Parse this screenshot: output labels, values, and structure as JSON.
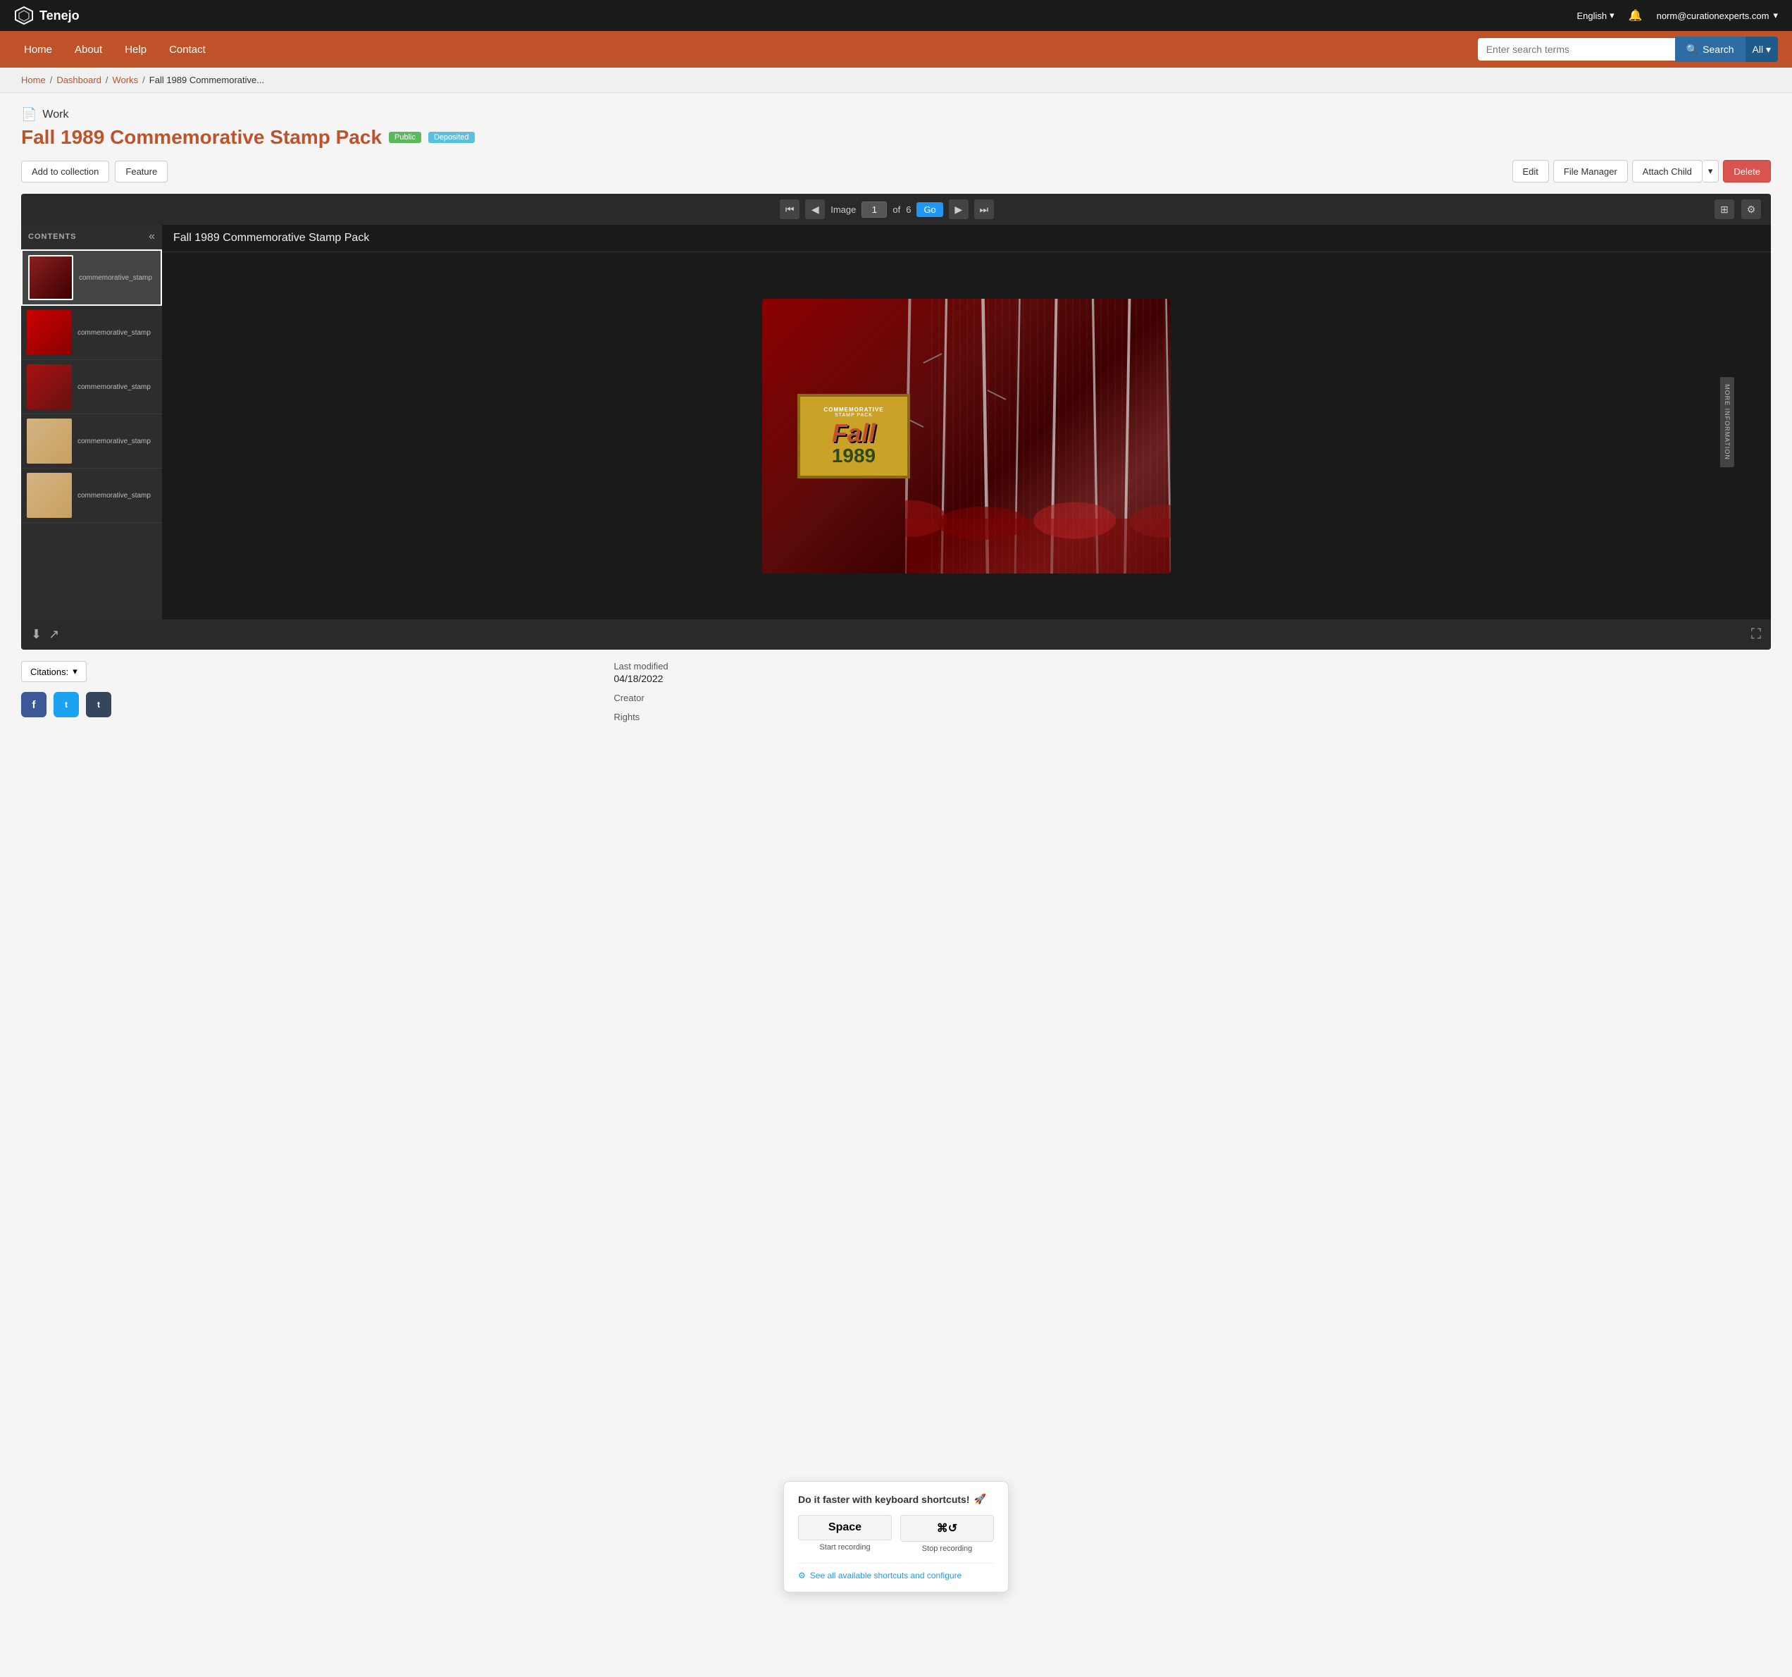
{
  "topbar": {
    "logo": "Tenejo",
    "language": "English",
    "bell_label": "Notifications",
    "user": "norm@curationexperts.com",
    "user_dropdown": "▾",
    "lang_dropdown": "▾"
  },
  "navbar": {
    "links": [
      {
        "label": "Home",
        "href": "#"
      },
      {
        "label": "About",
        "href": "#"
      },
      {
        "label": "Help",
        "href": "#"
      },
      {
        "label": "Contact",
        "href": "#"
      }
    ],
    "search": {
      "placeholder": "Enter search terms",
      "button_label": "Search",
      "all_label": "All",
      "all_dropdown": "▾"
    }
  },
  "breadcrumb": {
    "items": [
      {
        "label": "Home",
        "href": "#"
      },
      {
        "label": "Dashboard",
        "href": "#"
      },
      {
        "label": "Works",
        "href": "#"
      },
      {
        "label": "Fall 1989 Commemorative...",
        "current": true
      }
    ]
  },
  "work": {
    "type_label": "Work",
    "type_icon": "📄",
    "title": "Fall 1989 Commemorative Stamp Pack",
    "badge_public": "Public",
    "badge_deposited": "Deposited",
    "actions_left": [
      {
        "label": "Add to collection",
        "name": "add-to-collection-button"
      },
      {
        "label": "Feature",
        "name": "feature-button"
      }
    ],
    "actions_right": [
      {
        "label": "Edit",
        "name": "edit-button"
      },
      {
        "label": "File Manager",
        "name": "file-manager-button"
      },
      {
        "label": "Attach Child",
        "name": "attach-child-button"
      },
      {
        "label": "▾",
        "name": "attach-child-dropdown"
      },
      {
        "label": "Delete",
        "name": "delete-button"
      }
    ]
  },
  "viewer": {
    "image_label": "Image",
    "current_page": "1",
    "total_pages": "6",
    "go_btn": "Go",
    "title": "Fall 1989 Commemorative Stamp Pack",
    "contents_label": "CONTENTS",
    "more_info_label": "MORE INFORMATION",
    "thumbnails": [
      {
        "label": "commemorative_stamp",
        "active": true
      },
      {
        "label": "commemorative_stamp",
        "active": false
      },
      {
        "label": "commemorative_stamp",
        "active": false
      },
      {
        "label": "commemorative_stamp",
        "active": false
      },
      {
        "label": "commemorative_stamp",
        "active": false
      }
    ],
    "stamp": {
      "line1": "Commemorative",
      "line2": "Stamp Pack",
      "fall": "Fall",
      "year": "1989"
    },
    "footer_icons": [
      {
        "name": "download-icon",
        "symbol": "⬇"
      },
      {
        "name": "share-icon",
        "symbol": "↗"
      }
    ],
    "fullscreen_icon": "⛶"
  },
  "below_viewer": {
    "citations_btn": "Citations:",
    "citations_dropdown": "▾",
    "social": [
      {
        "name": "facebook-button",
        "label": "f",
        "class": "social-fb"
      },
      {
        "name": "twitter-button",
        "label": "t",
        "class": "social-tw"
      },
      {
        "name": "tumblr-button",
        "label": "t",
        "class": "social-tu"
      }
    ]
  },
  "metadata": {
    "last_modified_label": "Last modified",
    "last_modified_value": "04/18/2022",
    "creator_label": "Creator",
    "rights_label": "Rights"
  },
  "shortcut_popup": {
    "title": "Do it faster with keyboard shortcuts!",
    "title_emoji": "🚀",
    "shortcuts": [
      {
        "key": "Space",
        "modifiers": "",
        "label": "Start recording"
      },
      {
        "key": "⌘↺",
        "modifiers": "",
        "label": "Stop recording"
      }
    ],
    "link_emoji": "⚙",
    "link_label": "See all available shortcuts and configure"
  }
}
